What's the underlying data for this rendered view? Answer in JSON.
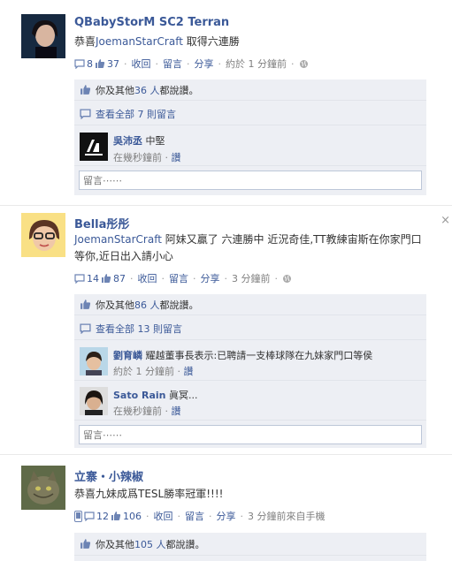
{
  "posts": [
    {
      "name": "QBabyStorM SC2 Terran",
      "message_prefix": "恭喜",
      "message_link": "JoemanStarCraft",
      "message_suffix": " 取得六連勝",
      "comment_count": "8",
      "like_count": "37",
      "actions": [
        "收回",
        "留言",
        "分享"
      ],
      "time": "約於 1 分鐘前",
      "likes_summary_prefix": "你及其他 ",
      "likes_summary_link": "36 人",
      "likes_summary_suffix": "都說讚。",
      "view_all": "查看全部 7 則留言",
      "comments": [
        {
          "name": "吳沛丞",
          "text": "中堅",
          "time": "在幾秒鐘前",
          "like": "讚"
        }
      ],
      "comment_placeholder": "留言⋯⋯"
    },
    {
      "name": "Bella彤彤",
      "message_link": "JoemanStarCraft",
      "message_suffix": " 阿妹又贏了 六連勝中 近況奇佳,TT教練宙斯在你家門口等你,近日出入請小心",
      "comment_count": "14",
      "like_count": "87",
      "actions": [
        "收回",
        "留言",
        "分享"
      ],
      "time": "3 分鐘前",
      "likes_summary_prefix": "你及其他 ",
      "likes_summary_link": "86 人",
      "likes_summary_suffix": "都說讚。",
      "view_all": "查看全部 13 則留言",
      "comments": [
        {
          "name": "劉育嶙",
          "text": "耀越董事長表示:已聘請一支棒球隊在九妹家門口等侯",
          "time": "約於 1 分鐘前",
          "like": "讚"
        },
        {
          "name": "Sato Rain",
          "text": "眞冥...",
          "time": "在幾秒鐘前",
          "like": "讚"
        }
      ],
      "comment_placeholder": "留言⋯⋯"
    },
    {
      "name": "立寨・小辣椒",
      "message": "恭喜九妹成爲TESL勝率冠軍!!!!",
      "comment_count": "12",
      "like_count": "106",
      "actions": [
        "收回",
        "留言",
        "分享"
      ],
      "time": "3 分鐘前來自手機",
      "likes_summary_prefix": "你及其他 ",
      "likes_summary_link": "105 人",
      "likes_summary_suffix": "都說讚。"
    }
  ],
  "close_glyph": "×",
  "colors": {
    "link": "#3b5998",
    "ufi_bg": "#edeff4",
    "muted": "#7f7f7f"
  }
}
